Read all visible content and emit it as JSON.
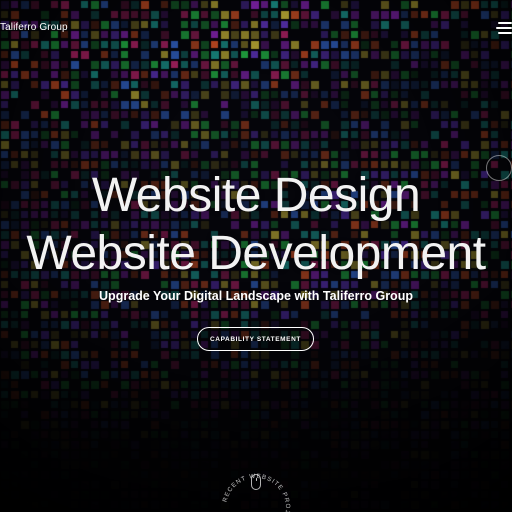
{
  "header": {
    "brand": "Taliferro Group",
    "menu_icon": "hamburger-menu-icon"
  },
  "hero": {
    "line1": "Website Design",
    "line2": "Website Development",
    "subtitle": "Upgrade Your Digital Landscape with Taliferro Group",
    "cta_label": "CAPABILITY STATEMENT"
  },
  "scroll": {
    "label": "RECENT WEBSITE PROJECTS",
    "icon": "mouse-scroll-icon"
  },
  "colors": {
    "text": "#ffffff",
    "background": "#05050a",
    "accent_green": "#2fd04a",
    "accent_magenta": "#d0206e",
    "accent_purple": "#6a3cd8"
  }
}
